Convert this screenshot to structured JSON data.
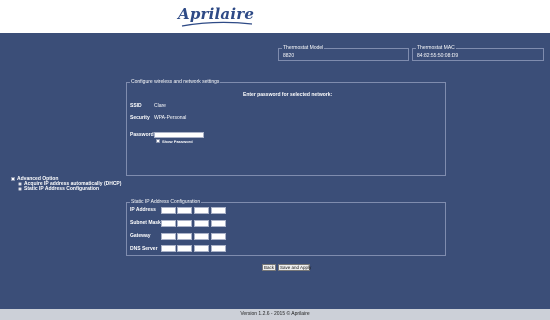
{
  "header": {
    "logo_text": "Aprilaire"
  },
  "thermostat": {
    "model_label": "Thermostat Model",
    "model_value": "8820",
    "mac_label": "Thermostat MAC",
    "mac_value": "84:82:55:50:08:D9"
  },
  "wireless": {
    "legend": "Configure wireless and network settings",
    "prompt": "Enter password for selected network:",
    "ssid_label": "SSID",
    "ssid_value": "Clare",
    "security_label": "Security",
    "security_value": "WPA-Personal",
    "password_label": "Password",
    "password_value": "",
    "show_password_label": "Show Password"
  },
  "advanced": {
    "label": "Advanced Option",
    "option_auto": "Acquire IP address automatically (DHCP)",
    "option_static": "Static IP Address Configuration"
  },
  "static_ip": {
    "legend": "Static IP Address Configuration",
    "ip_label": "IP Address",
    "subnet_label": "Subnet Mask",
    "gateway_label": "Gateway",
    "dns_label": "DNS Server"
  },
  "buttons": {
    "back": "Back",
    "save": "Save and Apply"
  },
  "footer": {
    "text": "Version 1.2.6 - 2015 © Aprilaire"
  },
  "colors": {
    "background": "#3b4e78",
    "header": "#ffffff",
    "logo": "#2e4a86",
    "footer": "#ccd0d8"
  }
}
